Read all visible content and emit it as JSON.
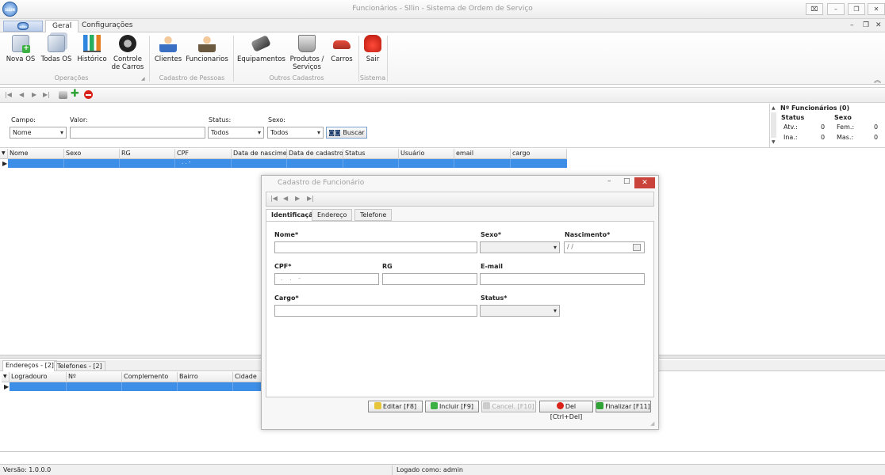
{
  "window": {
    "title": "Funcionários - Sllin - Sistema de Ordem de Serviço",
    "logo_text": "SLLIN"
  },
  "menu_tabs": [
    {
      "label": "Geral"
    },
    {
      "label": "Configurações"
    }
  ],
  "ribbon": {
    "buttons": {
      "nova_os": "Nova OS",
      "todas_os": "Todas OS",
      "historico": "Histórico",
      "controle_carros": "Controle de Carros",
      "clientes": "Clientes",
      "funcionarios": "Funcionarios",
      "equipamentos": "Equipamentos",
      "produtos_servicos": "Produtos / Serviços",
      "carros": "Carros",
      "sair": "Sair"
    },
    "groups": {
      "operacoes": "Operações",
      "cadastro_pessoas": "Cadastro de Pessoas",
      "outros_cadastros": "Outros Cadastros",
      "sistema": "Sistema"
    }
  },
  "filter": {
    "campo_label": "Campo:",
    "campo_value": "Nome",
    "valor_label": "Valor:",
    "valor_value": "",
    "status_label": "Status:",
    "status_value": "Todos",
    "sexo_label": "Sexo:",
    "sexo_value": "Todos",
    "buscar_label": "Buscar"
  },
  "stats": {
    "title": "Nº Funcionários (0)",
    "status_header": "Status",
    "sexo_header": "Sexo",
    "atv_label": "Atv.:",
    "atv_value": "0",
    "ina_label": "Ina.:",
    "ina_value": "0",
    "fem_label": "Fem.:",
    "fem_value": "0",
    "mas_label": "Mas.:",
    "mas_value": "0"
  },
  "main_grid": {
    "columns": [
      "Nome",
      "Sexo",
      "RG",
      "CPF",
      "Data de nascime...",
      "Data de cadastro",
      "Status",
      "Usuário",
      "email",
      "cargo"
    ],
    "row_cpf_mask": ". . -"
  },
  "bottom": {
    "tabs": [
      "Endereços - [2]",
      "Telefones - [2]"
    ],
    "columns": [
      "Logradouro",
      "Nº",
      "Complemento",
      "Bairro",
      "Cidade"
    ]
  },
  "dialog": {
    "title": "Cadastro de Funcionário",
    "tabs": [
      "Identificação",
      "Endereço",
      "Telefone"
    ],
    "labels": {
      "nome": "Nome*",
      "sexo": "Sexo*",
      "nascimento": "Nascimento*",
      "cpf": "CPF*",
      "rg": "RG",
      "email": "E-mail",
      "cargo": "Cargo*",
      "status": "Status*"
    },
    "values": {
      "nome": "",
      "nascimento": " /  /",
      "cpf": ". . -",
      "rg": "",
      "email": "",
      "cargo": ""
    },
    "buttons": {
      "editar": "Editar [F8]",
      "incluir": "Incluir [F9]",
      "cancel": "Cancel. [F10]",
      "del": "Del [Ctrl+Del]",
      "finalizar": "Finalizar [F11]"
    }
  },
  "statusbar": {
    "version": "Versão: 1.0.0.0",
    "user": "Logado como: admin"
  },
  "colors": {
    "selection": "#3d8ee6",
    "close_red": "#d9534f",
    "accent": "#2d5e9e"
  }
}
